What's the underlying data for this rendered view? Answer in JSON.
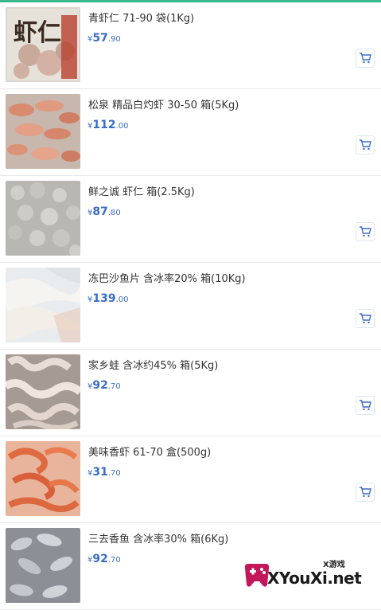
{
  "products": [
    {
      "name": "青虾仁 71-90 袋(1Kg)",
      "currency": "¥",
      "price_int": "57",
      "price_dec": ".90",
      "thumb_text": "虾仁"
    },
    {
      "name": "松泉 精品白灼虾 30-50 箱(5Kg)",
      "currency": "¥",
      "price_int": "112",
      "price_dec": ".00"
    },
    {
      "name": "鲜之诚 虾仁 箱(2.5Kg)",
      "currency": "¥",
      "price_int": "87",
      "price_dec": ".80"
    },
    {
      "name": "冻巴沙鱼片 含冰率20% 箱(10Kg)",
      "currency": "¥",
      "price_int": "139",
      "price_dec": ".00"
    },
    {
      "name": "家乡蛙 含冰约45% 箱(5Kg)",
      "currency": "¥",
      "price_int": "92",
      "price_dec": ".70"
    },
    {
      "name": "美味香虾 61-70 盒(500g)",
      "currency": "¥",
      "price_int": "31",
      "price_dec": ".70"
    },
    {
      "name": "三去香鱼 含冰率30% 箱(6Kg)",
      "currency": "¥",
      "price_int": "92",
      "price_dec": ".70"
    }
  ],
  "icons": {
    "cart": "cart-icon"
  },
  "watermark": {
    "tag": "X游戏",
    "text": "XYouXi.net"
  },
  "colors": {
    "accent": "#39b88e",
    "price": "#3a6cc6",
    "cart": "#3a6cc6"
  }
}
